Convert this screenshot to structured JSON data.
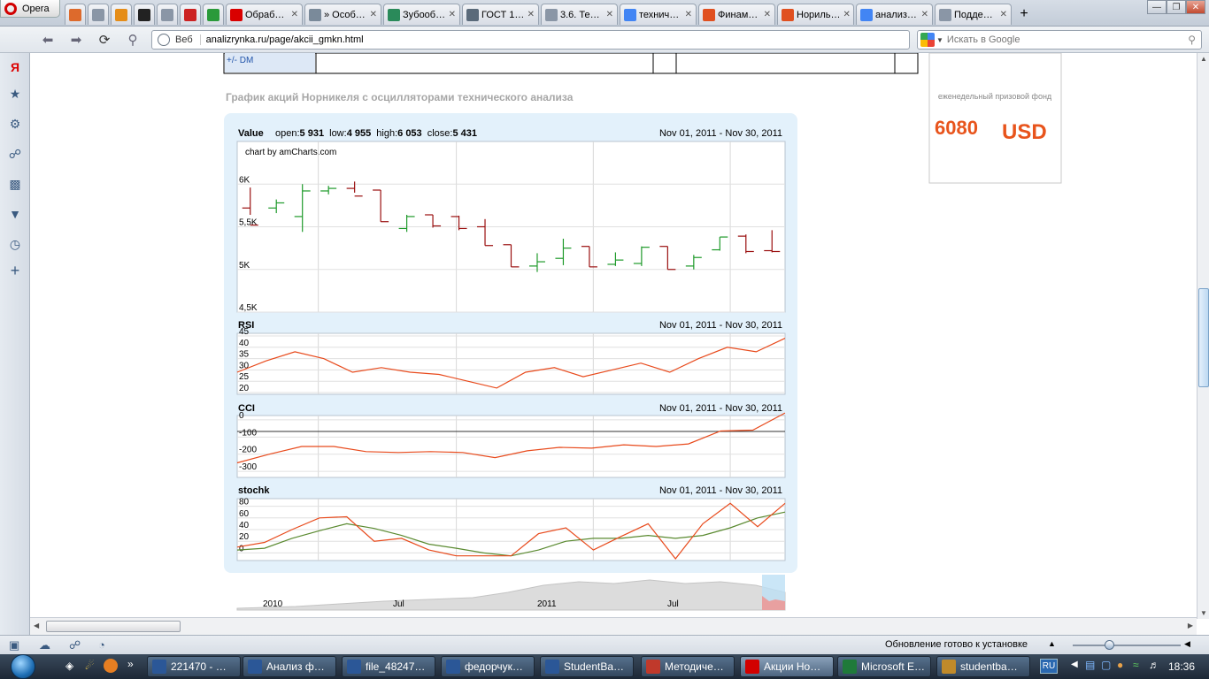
{
  "browser": {
    "menu_label": "Opera",
    "tabs": [
      {
        "label": "",
        "icon": "search-icon",
        "color": "#dd6a2c"
      },
      {
        "label": "",
        "icon": "page-icon",
        "color": "#8a96a6"
      },
      {
        "label": "",
        "icon": "grid-icon",
        "color": "#e58d18"
      },
      {
        "label": "",
        "icon": "cat-icon",
        "color": "#222222"
      },
      {
        "label": "",
        "icon": "document-icon",
        "color": "#8a96a6"
      },
      {
        "label": "",
        "icon": "gr-icon",
        "color": "#cc2222"
      },
      {
        "label": "",
        "icon": "trend-icon",
        "color": "#2a9a3a"
      },
      {
        "label": "Обраб…",
        "icon": "yandex-icon",
        "color": "#d90000"
      },
      {
        "label": "» Особ…",
        "icon": "sim-icon",
        "color": "#7a8a9a"
      },
      {
        "label": "Зубооб…",
        "icon": "globe-icon",
        "color": "#2a8a5a"
      },
      {
        "label": "ГОСТ 1…",
        "icon": "m-icon",
        "color": "#5a6a7a"
      },
      {
        "label": "3.6. Те…",
        "icon": "page-icon",
        "color": "#8a96a6"
      },
      {
        "label": "технич…",
        "icon": "google-icon",
        "color": "#4285f4"
      },
      {
        "label": "Финам…",
        "icon": "finam-icon",
        "color": "#e05020"
      },
      {
        "label": "Нориль…",
        "icon": "chart-icon",
        "color": "#e05020"
      },
      {
        "label": "анализ…",
        "icon": "google-icon",
        "color": "#4285f4"
      },
      {
        "label": "Подде…",
        "icon": "page-icon",
        "color": "#8a96a6"
      }
    ],
    "web_label": "Веб",
    "url": "analizrynka.ru/page/akcii_gmkn.html",
    "search_placeholder": "Искать в Google",
    "status_text": "Обновление готово к установке"
  },
  "page": {
    "table_row_label": "+/- DM",
    "section_title": "График акций Норникеля с осцилляторами технического анализа",
    "ad_caption": "еженедельный призовой фонд",
    "ad_amount": "6080",
    "ad_currency": "USD"
  },
  "chart_data": {
    "type": "stock-chart",
    "date_range": "Nov 01, 2011 - Nov 30, 2011",
    "credit": "chart by amCharts.com",
    "value_panel": {
      "title": "Value",
      "legend_labels": {
        "open": "open:",
        "low": "low:",
        "high": "high:",
        "close": "close:"
      },
      "legend_values": {
        "open": "5 931",
        "low": "4 955",
        "high": "6 053",
        "close": "5 431"
      },
      "y_ticks": [
        "6K",
        "5,5K",
        "5K",
        "4,5K"
      ],
      "y_range": [
        4500,
        6500
      ],
      "ohlc": [
        {
          "o": 5720,
          "h": 5960,
          "l": 5640,
          "c": 5520
        },
        {
          "o": 5720,
          "h": 5820,
          "l": 5660,
          "c": 5780
        },
        {
          "o": 5620,
          "h": 6000,
          "l": 5440,
          "c": 5920
        },
        {
          "o": 5920,
          "h": 5980,
          "l": 5880,
          "c": 5950
        },
        {
          "o": 5950,
          "h": 6030,
          "l": 5900,
          "c": 5860
        },
        {
          "o": 5930,
          "h": 5930,
          "l": 5560,
          "c": 5560
        },
        {
          "o": 5480,
          "h": 5640,
          "l": 5440,
          "c": 5620
        },
        {
          "o": 5640,
          "h": 5640,
          "l": 5490,
          "c": 5510
        },
        {
          "o": 5620,
          "h": 5630,
          "l": 5460,
          "c": 5480
        },
        {
          "o": 5500,
          "h": 5590,
          "l": 5280,
          "c": 5280
        },
        {
          "o": 5290,
          "h": 5290,
          "l": 5030,
          "c": 5030
        },
        {
          "o": 5040,
          "h": 5190,
          "l": 4970,
          "c": 5090
        },
        {
          "o": 5130,
          "h": 5360,
          "l": 5050,
          "c": 5250
        },
        {
          "o": 5270,
          "h": 5270,
          "l": 5030,
          "c": 5030
        },
        {
          "o": 5060,
          "h": 5200,
          "l": 5040,
          "c": 5110
        },
        {
          "o": 5070,
          "h": 5270,
          "l": 5040,
          "c": 5260
        },
        {
          "o": 5270,
          "h": 5270,
          "l": 5000,
          "c": 5000
        },
        {
          "o": 5040,
          "h": 5170,
          "l": 5000,
          "c": 5140
        },
        {
          "o": 5230,
          "h": 5380,
          "l": 5220,
          "c": 5380
        },
        {
          "o": 5390,
          "h": 5410,
          "l": 5190,
          "c": 5210
        },
        {
          "o": 5220,
          "h": 5460,
          "l": 5200,
          "c": 5210
        }
      ]
    },
    "rsi_panel": {
      "title": "RSI",
      "y_ticks": [
        "45",
        "40",
        "35",
        "30",
        "25",
        "20"
      ],
      "y_range": [
        20,
        45
      ],
      "values": [
        29,
        34,
        38,
        35,
        29,
        31,
        29,
        28,
        25,
        22,
        29,
        31,
        27,
        30,
        33,
        29,
        35,
        40,
        38,
        44
      ]
    },
    "cci_panel": {
      "title": "CCI",
      "y_ticks": [
        "0",
        "-100",
        "-200",
        "-300"
      ],
      "y_range": [
        -300,
        50
      ],
      "values": [
        -250,
        -200,
        -155,
        -155,
        -185,
        -190,
        -185,
        -190,
        -220,
        -180,
        -160,
        -165,
        -145,
        -155,
        -140,
        -65,
        -60,
        40
      ]
    },
    "stoch_panel": {
      "title": "stochk",
      "y_ticks": [
        "80",
        "60",
        "40",
        "20",
        "0"
      ],
      "y_range": [
        -10,
        90
      ],
      "k_values": [
        10,
        18,
        40,
        60,
        62,
        20,
        25,
        5,
        -5,
        -5,
        -5,
        33,
        43,
        5,
        28,
        50,
        -10,
        50,
        85,
        45,
        85
      ],
      "d_values": [
        5,
        8,
        25,
        38,
        50,
        42,
        30,
        15,
        8,
        0,
        -5,
        5,
        20,
        25,
        25,
        30,
        25,
        30,
        43,
        60,
        70
      ],
      "k_color": "#e84a1c",
      "d_color": "#5a8a30"
    },
    "navigator": {
      "labels": [
        "2010",
        "Jul",
        "2011",
        "Jul"
      ]
    },
    "colors": {
      "up": "#1e9a2a",
      "down": "#9a0f0f",
      "line": "#e84a1c",
      "panel_bg": "#e3f1fb"
    }
  },
  "taskbar": {
    "items": [
      {
        "label": "221470 - …",
        "icon": "word-icon",
        "color": "#2b5797"
      },
      {
        "label": "Анализ ф…",
        "icon": "word-icon",
        "color": "#2b5797"
      },
      {
        "label": "file_48247…",
        "icon": "word-icon",
        "color": "#2b5797"
      },
      {
        "label": "федорчук…",
        "icon": "word-icon",
        "color": "#2b5797"
      },
      {
        "label": "StudentBa…",
        "icon": "word-icon",
        "color": "#2b5797"
      },
      {
        "label": "Методиче…",
        "icon": "pdf-icon",
        "color": "#c0392b"
      },
      {
        "label": "Акции Но…",
        "icon": "opera-icon",
        "color": "#d20000"
      },
      {
        "label": "Microsoft E…",
        "icon": "excel-icon",
        "color": "#1f7a3a"
      },
      {
        "label": "studentba…",
        "icon": "folder-icon",
        "color": "#c08a2a"
      }
    ],
    "language": "RU",
    "clock": "18:36"
  }
}
